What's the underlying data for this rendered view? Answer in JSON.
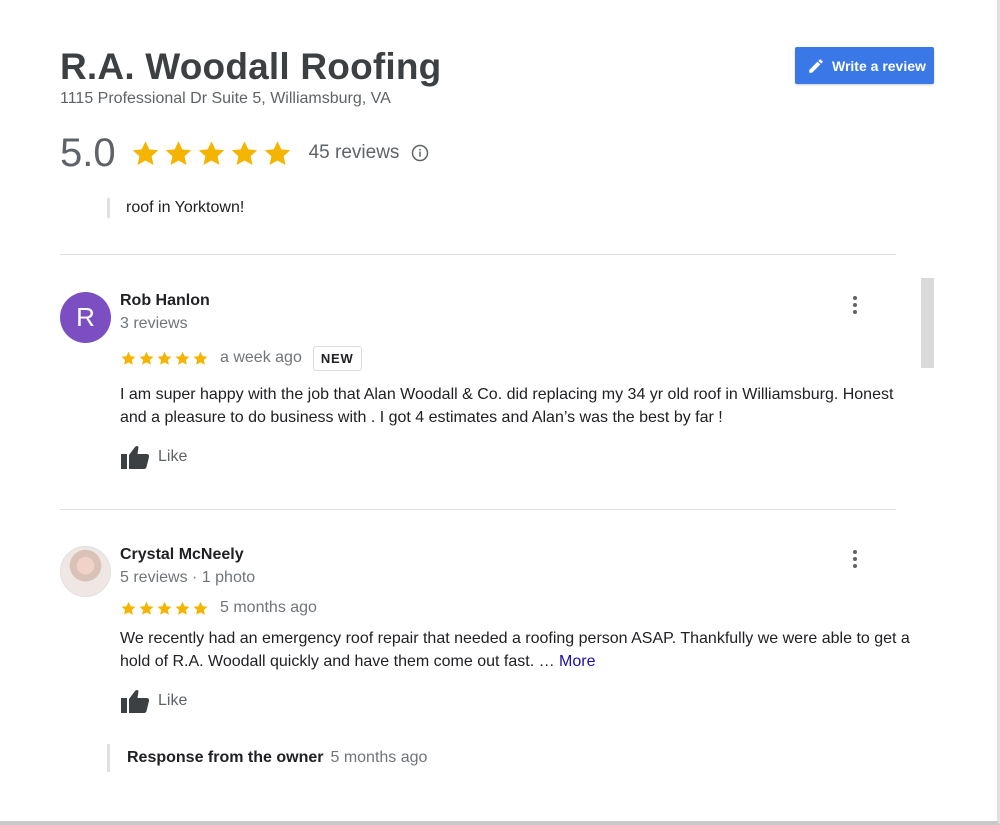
{
  "business": {
    "name": "R.A. Woodall Roofing",
    "address": "1115 Professional Dr Suite 5, Williamsburg, VA",
    "write_review_label": "Write a review"
  },
  "rating": {
    "score": "5.0",
    "stars": 5,
    "reviews_count": "45 reviews"
  },
  "previous_snippet": "roof in Yorktown!",
  "reviews": [
    {
      "avatar_letter": "R",
      "avatar_color": "#7b4fc2",
      "name": "Rob Hanlon",
      "meta": "3 reviews",
      "stars": 5,
      "time": "a week ago",
      "badge": "NEW",
      "text": "I am super happy with the job that Alan Woodall & Co. did replacing my 34 yr old roof in Williamsburg. Honest and a pleasure to do business with . I got 4 estimates and Alan’s was the best by far !",
      "like_label": "Like"
    },
    {
      "name": "Crystal McNeely",
      "meta": "5 reviews · 1 photo",
      "stars": 5,
      "time": "5 months ago",
      "text": "We recently had an emergency roof repair that needed a roofing person ASAP. Thankfully we were able to get a hold of R.A. Woodall quickly and have them come out fast. …",
      "more_label": "More",
      "like_label": "Like",
      "owner_response": {
        "label": "Response from the owner",
        "time": "5 months ago"
      }
    }
  ],
  "colors": {
    "star": "#f4b400",
    "accent_button": "#3b78e7",
    "link": "#1a0dab"
  },
  "icons": [
    "pencil-icon",
    "star-icon",
    "info-icon",
    "more-vert-icon",
    "thumb-up-icon"
  ]
}
